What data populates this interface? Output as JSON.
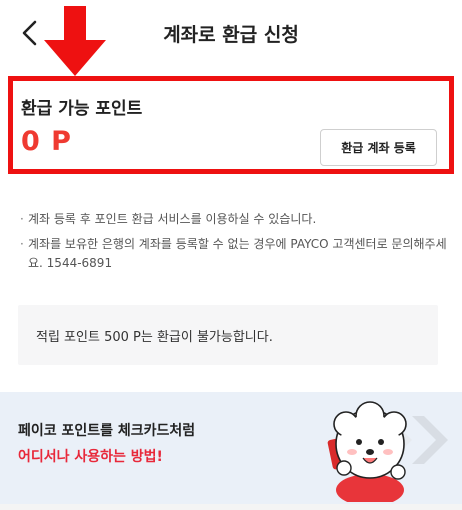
{
  "header": {
    "title": "계좌로 환급 신청",
    "back_icon": "chevron-left-icon"
  },
  "point_card": {
    "label": "환급 가능 포인트",
    "value": "0 P",
    "register_button": "환급 계좌 등록"
  },
  "notices": [
    "계좌 등록 후 포인트 환급 서비스를 이용하실 수 있습니다.",
    "계좌를 보유한 은행의 계좌를 등록할 수 없는 경우에 PAYCO 고객센터로 문의해주세요. 1544-6891"
  ],
  "info_box": {
    "text": "적립 포인트 500 P는 환급이 불가능합니다."
  },
  "banner": {
    "line1": "페이코 포인트를 체크카드처럼",
    "line2": "어디서나 사용하는 방법!"
  },
  "colors": {
    "accent_red": "#ef3a31",
    "highlight_border": "#ee1111",
    "banner_bg": "#eaf0f8",
    "banner_red": "#e8283a"
  }
}
